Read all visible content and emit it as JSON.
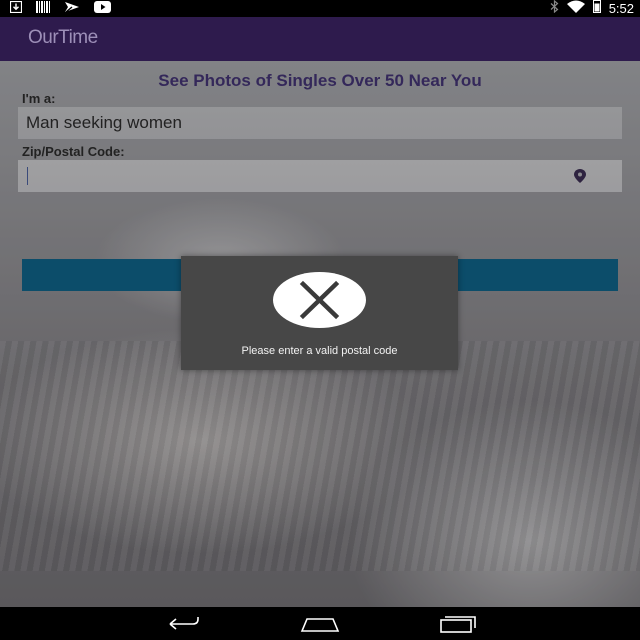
{
  "status_bar": {
    "left_icons": [
      "download-icon",
      "barcode-icon",
      "notification-flag-icon",
      "youtube-icon"
    ],
    "right_icons": [
      "bluetooth-icon",
      "wifi-icon",
      "battery-icon"
    ],
    "time": "5:52"
  },
  "app_bar": {
    "logo": "OurTime"
  },
  "form": {
    "headline": "See Photos of Singles Over 50 Near You",
    "gender_label": "I'm a:",
    "gender_value": "Man seeking women",
    "zip_label": "Zip/Postal Code:",
    "zip_value": "",
    "location_icon": "location-pin-icon"
  },
  "dialog": {
    "icon": "close-x-icon",
    "message": "Please enter a valid postal code"
  },
  "nav_bar": {
    "buttons": [
      "back-icon",
      "home-icon",
      "recent-apps-icon"
    ]
  },
  "colors": {
    "app_bar": "#2e1b4d",
    "headline": "#34285a",
    "submit_button": "#0c4d6a",
    "dialog_bg": "#474747"
  }
}
